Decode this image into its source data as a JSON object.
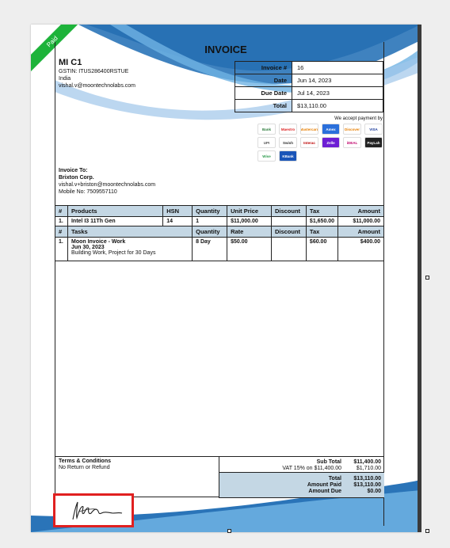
{
  "ribbon": "Paid",
  "title": "INVOICE",
  "company": {
    "name": "MI C1",
    "gstin": "GSTIN: ITUS286400RSTUE",
    "country": "India",
    "email": "vishal.v@moontechnolabs.com"
  },
  "meta": [
    {
      "label": "Invoice #",
      "value": "16"
    },
    {
      "label": "Date",
      "value": "Jun 14, 2023"
    },
    {
      "label": "Due Date",
      "value": "Jul 14, 2023"
    },
    {
      "label": "Total",
      "value": "$13,110.00"
    }
  ],
  "payment": {
    "heading": "We accept payment by",
    "logos": [
      "Bank",
      "Maestro",
      "Mastercard",
      "Amex",
      "Discover",
      "VISA",
      "UPI",
      "Swish",
      "Interac",
      "Zelle",
      "iDEAL",
      "PayLah",
      "Wise",
      "KBank"
    ]
  },
  "bill_to": {
    "heading": "Invoice To:",
    "name": "Brixton Corp.",
    "email": "vishal.v+briston@moontechnolabs.com",
    "mobile": "Mobile No: 7509557110"
  },
  "products": {
    "headers": [
      "#",
      "Products",
      "HSN",
      "Quantity",
      "Unit Price",
      "Discount",
      "Tax",
      "Amount"
    ],
    "rows": [
      [
        "1.",
        "Intel I3 11Th Gen",
        "14",
        "1",
        "$11,000.00",
        "",
        "$1,650.00",
        "$11,000.00"
      ]
    ]
  },
  "tasks": {
    "headers": [
      "#",
      "Tasks",
      "",
      "Quantity",
      "Rate",
      "Discount",
      "Tax",
      "Amount"
    ],
    "rows": [
      {
        "num": "1.",
        "name": "Moon Invoice - Work",
        "date": "Jun 30, 2023",
        "desc": "Building Work, Project for 30 Days",
        "qty": "8 Day",
        "rate": "$50.00",
        "discount": "",
        "tax": "$60.00",
        "amount": "$400.00"
      }
    ]
  },
  "terms": {
    "heading": "Terms & Conditions",
    "text": "No Return or Refund"
  },
  "totals": [
    {
      "label": "Sub Total",
      "value": "$11,400.00",
      "bold": true
    },
    {
      "label": "VAT 15% on $11,400.00",
      "value": "$1,710.00",
      "bold": false
    },
    {
      "label": "Total",
      "value": "$13,110.00",
      "bold": true
    },
    {
      "label": "Amount Paid",
      "value": "$13,110.00",
      "bold": true
    },
    {
      "label": "Amount Due",
      "value": "$0.00",
      "bold": true
    }
  ]
}
